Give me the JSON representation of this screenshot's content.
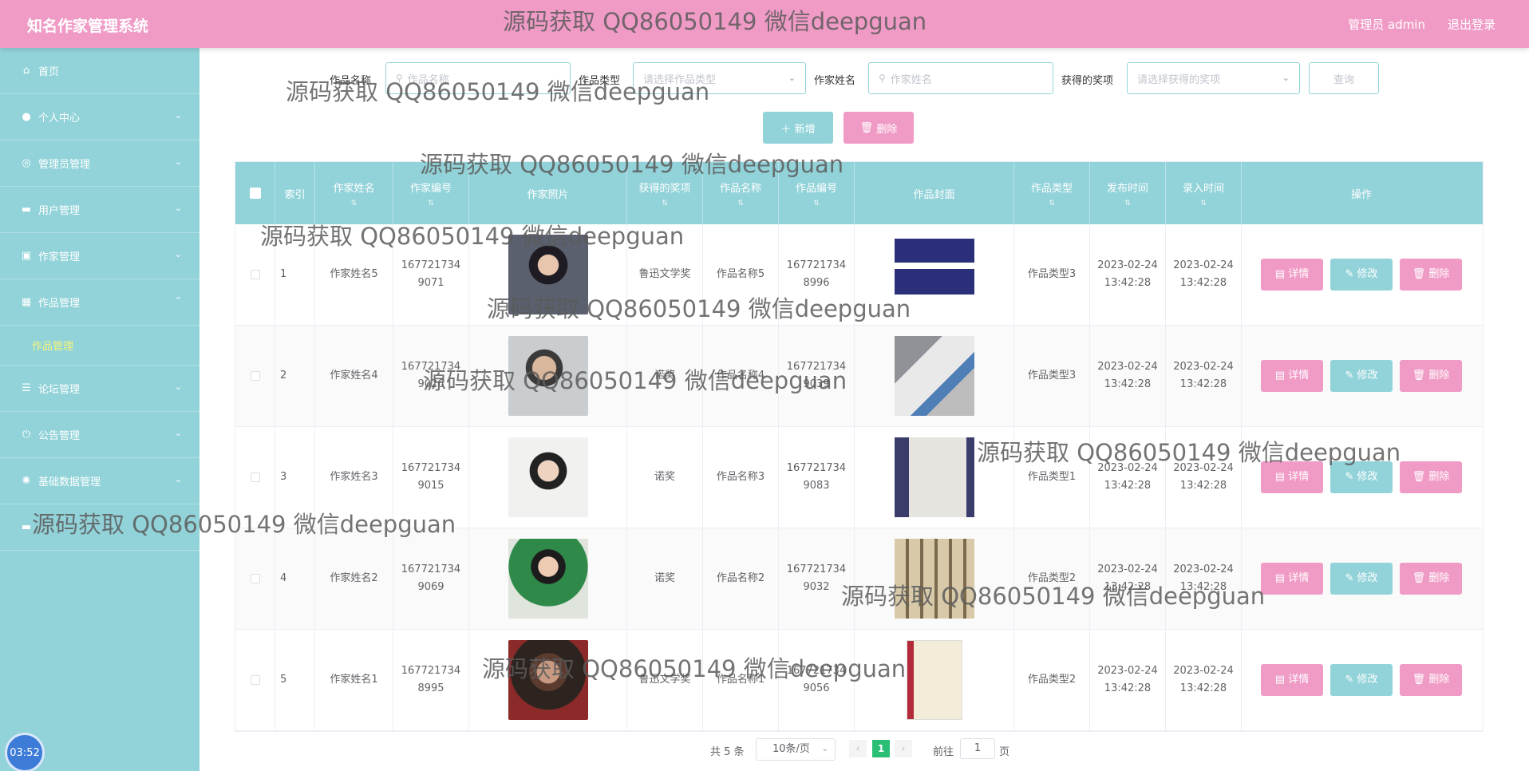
{
  "header": {
    "app_title": "知名作家管理系统",
    "user": "管理员 admin",
    "logout": "退出登录"
  },
  "sidebar": {
    "items": [
      {
        "icon": "home-icon",
        "glyph": "⌂",
        "label": "首页"
      },
      {
        "icon": "user-icon",
        "glyph": "●",
        "label": "个人中心"
      },
      {
        "icon": "settings-icon",
        "glyph": "◎",
        "label": "管理员管理"
      },
      {
        "icon": "id-card-icon",
        "glyph": "▬",
        "label": "用户管理"
      },
      {
        "icon": "briefcase-icon",
        "glyph": "▣",
        "label": "作家管理"
      },
      {
        "icon": "grid-icon",
        "glyph": "▦",
        "label": "作品管理"
      },
      {
        "icon": "list-icon",
        "glyph": "☰",
        "label": "论坛管理"
      },
      {
        "icon": "power-icon",
        "glyph": "⏻",
        "label": "公告管理"
      },
      {
        "icon": "aperture-icon",
        "glyph": "✺",
        "label": "基础数据管理"
      }
    ],
    "submenu_label": "作品管理",
    "clock": "03:52"
  },
  "search": {
    "work_name_label": "作品名称",
    "work_name_placeholder": "作品名称",
    "work_type_label": "作品类型",
    "work_type_placeholder": "请选择作品类型",
    "author_name_label": "作家姓名",
    "author_name_placeholder": "作家姓名",
    "award_label": "获得的奖项",
    "award_placeholder": "请选择获得的奖项",
    "query_label": "查询"
  },
  "actions": {
    "add_label": "新增",
    "delete_label": "删除"
  },
  "table": {
    "headers": [
      "索引",
      "作家姓名",
      "作家编号",
      "作家照片",
      "获得的奖项",
      "作品名称",
      "作品编号",
      "作品封面",
      "作品类型",
      "发布时间",
      "录入时间",
      "操作"
    ],
    "rows": [
      {
        "index": "1",
        "author": "作家姓名5",
        "author_no": "1677217349071",
        "award": "鲁迅文学奖",
        "work": "作品名称5",
        "work_no": "1677217348996",
        "type": "作品类型3",
        "publish": "2023-02-24 13:42:28",
        "entry": "2023-02-24 13:42:28"
      },
      {
        "index": "2",
        "author": "作家姓名4",
        "author_no": "1677217349026",
        "award": "诺奖",
        "work": "作品名称4",
        "work_no": "1677217349039",
        "type": "作品类型3",
        "publish": "2023-02-24 13:42:28",
        "entry": "2023-02-24 13:42:28"
      },
      {
        "index": "3",
        "author": "作家姓名3",
        "author_no": "1677217349015",
        "award": "诺奖",
        "work": "作品名称3",
        "work_no": "1677217349083",
        "type": "作品类型1",
        "publish": "2023-02-24 13:42:28",
        "entry": "2023-02-24 13:42:28"
      },
      {
        "index": "4",
        "author": "作家姓名2",
        "author_no": "1677217349069",
        "award": "诺奖",
        "work": "作品名称2",
        "work_no": "1677217349032",
        "type": "作品类型2",
        "publish": "2023-02-24 13:42:28",
        "entry": "2023-02-24 13:42:28"
      },
      {
        "index": "5",
        "author": "作家姓名1",
        "author_no": "1677217348995",
        "award": "鲁迅文学奖",
        "work": "作品名称1",
        "work_no": "1677217349056",
        "type": "作品类型2",
        "publish": "2023-02-24 13:42:28",
        "entry": "2023-02-24 13:42:28"
      }
    ],
    "row_buttons": {
      "detail": "详情",
      "edit": "修改",
      "delete": "删除"
    }
  },
  "pagination": {
    "total": "共 5 条",
    "page_size": "10条/页",
    "current_page": "1",
    "goto_label": "前往",
    "goto_value": "1",
    "goto_suffix": "页"
  },
  "watermark": "源码获取 QQ86050149 微信deepguan"
}
